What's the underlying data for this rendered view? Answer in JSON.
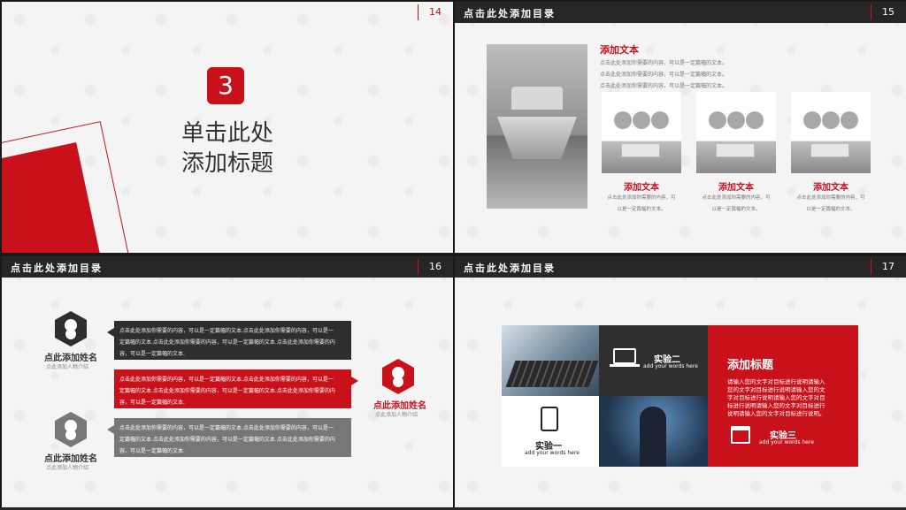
{
  "colors": {
    "accent": "#c8111b",
    "header": "#262626",
    "background": "#f4f4f4"
  },
  "slide14": {
    "number": "14",
    "section_number": "3",
    "title_line1": "单击此处",
    "title_line2": "添加标题"
  },
  "slide15": {
    "header_title": "点击此处添加目录",
    "number": "15",
    "main_title": "添加文本",
    "main_lines": [
      "点击此处添加你需要的内容，可以是一定篇幅的文本。",
      "点击此处添加你需要的内容，可以是一定篇幅的文本。",
      "点击此处添加你需要的内容，可以是一定篇幅的文本。"
    ],
    "items": [
      {
        "title": "添加文本",
        "desc1": "点击此处添加你需要的内容，可",
        "desc2": "以是一定篇幅的文本。"
      },
      {
        "title": "添加文本",
        "desc1": "点击此处添加你需要的内容，可",
        "desc2": "以是一定篇幅的文本。"
      },
      {
        "title": "添加文本",
        "desc1": "点击此处添加你需要的内容，可",
        "desc2": "以是一定篇幅的文本。"
      }
    ]
  },
  "slide16": {
    "header_title": "点击此处添加目录",
    "number": "16",
    "persons": [
      {
        "name": "点此添加姓名",
        "desc": "点此添加人物介绍",
        "icon": "user-icon"
      },
      {
        "name": "点此添加姓名",
        "desc": "点此添加人物介绍",
        "icon": "user-icon"
      },
      {
        "name": "点此添加姓名",
        "desc": "点此添加人物介绍",
        "icon": "user-icon"
      }
    ],
    "bubbles": [
      {
        "line1": "点击此处添加你需要的内容，可以是一定篇幅的文本.点击此处添加你需要的内容，可以是一",
        "line2": "定篇幅的文本.点击此处添加你需要的内容，可以是一定篇幅的文本.点击此处添加你需要的内",
        "line3": "容，可以是一定篇幅的文本."
      },
      {
        "line1": "点击此处添加你需要的内容，可以是一定篇幅的文本.点击此处添加你需要的内容，可以是一",
        "line2": "定篇幅的文本.点击此处添加你需要的内容，可以是一定篇幅的文本.点击此处添加你需要的内",
        "line3": "容，可以是一定篇幅的文本."
      },
      {
        "line1": "点击此处添加你需要的内容，可以是一定篇幅的文本.点击此处添加你需要的内容，可以是一",
        "line2": "定篇幅的文本.点击此处添加你需要的内容，可以是一定篇幅的文本.点击此处添加你需要的内",
        "line3": "容，可以是一定篇幅的文本."
      }
    ]
  },
  "slide17": {
    "header_title": "点击此处添加目录",
    "number": "17",
    "experiments": [
      {
        "name": "实验一",
        "sub": "add your words here",
        "icon": "phone-icon"
      },
      {
        "name": "实验二",
        "sub": "add your words here",
        "icon": "laptop-icon"
      },
      {
        "name": "实验三",
        "sub": "add your words here",
        "icon": "calendar-icon"
      }
    ],
    "panel_title": "添加标题",
    "panel_lines": [
      "请输入您的文字对目标进行说明请输入",
      "您的文字对目标进行说明请输入您的文",
      "字对目标进行说明请输入您的文字对目",
      "标进行说明请输入您的文字对目标进行",
      "说明请输入您的文字对目标进行说明。"
    ]
  }
}
